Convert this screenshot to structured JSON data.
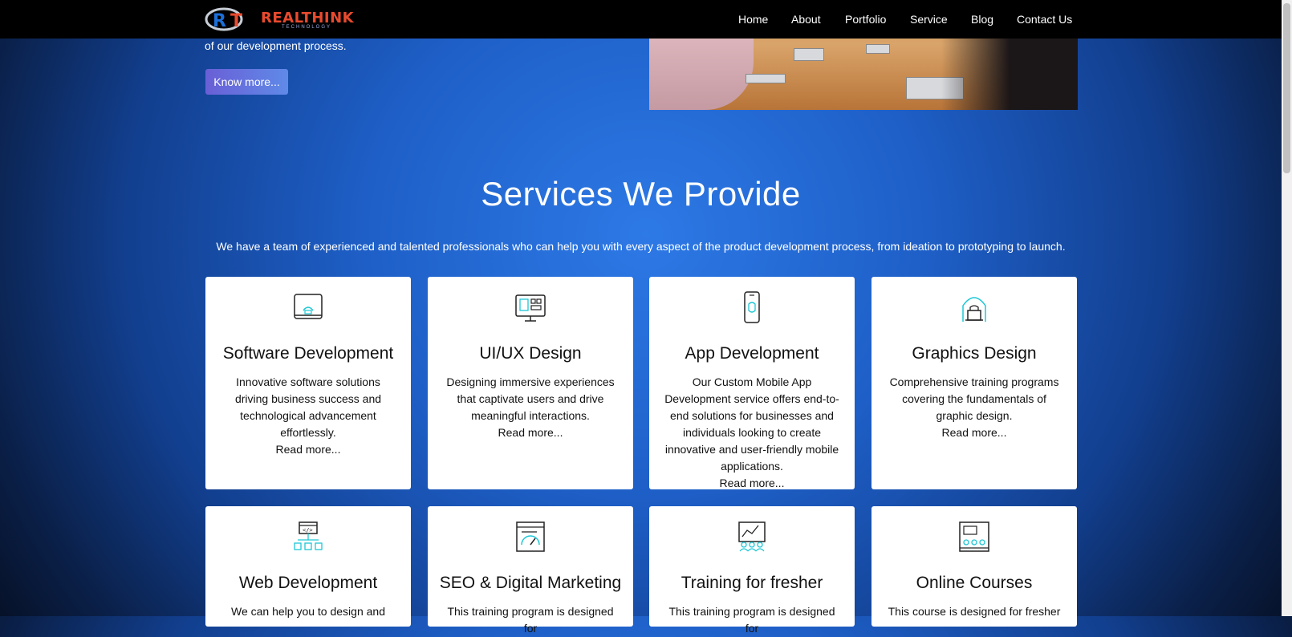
{
  "brand": {
    "name": "REALTHINK",
    "tagline": "TECHNOLOGY"
  },
  "nav": {
    "items": [
      "Home",
      "About",
      "Portfolio",
      "Service",
      "Blog",
      "Contact Us"
    ]
  },
  "hero": {
    "text": "of our development process.",
    "button_label": "Know more..."
  },
  "services": {
    "title": "Services We Provide",
    "subtitle": "We have a team of experienced and talented professionals who can help you with every aspect of the product development process, from ideation to prototyping to launch.",
    "cards": [
      {
        "icon": "laptop-icon",
        "title": "Software Development",
        "desc": "Innovative software solutions driving business success and technological advancement effortlessly.",
        "more": "Read more..."
      },
      {
        "icon": "ui-design-icon",
        "title": "UI/UX Design",
        "desc": "Designing immersive experiences that captivate users and drive meaningful interactions.",
        "more": "Read more..."
      },
      {
        "icon": "smartphone-icon",
        "title": "App Development",
        "desc": "Our Custom Mobile App Development service offers end-to-end solutions for businesses and individuals looking to create innovative and user-friendly mobile applications.",
        "more": "Read more..."
      },
      {
        "icon": "designer-icon",
        "title": "Graphics Design",
        "desc": "Comprehensive training programs covering the fundamentals of graphic design.",
        "more": "Read more..."
      },
      {
        "icon": "web-network-icon",
        "title": "Web Development",
        "desc": "We can help you to design and",
        "more": ""
      },
      {
        "icon": "seo-gauge-icon",
        "title": "SEO & Digital Marketing",
        "desc": "This training program is designed for",
        "more": ""
      },
      {
        "icon": "training-board-icon",
        "title": "Training for fresher",
        "desc": "This training program is designed for",
        "more": ""
      },
      {
        "icon": "online-course-icon",
        "title": "Online Courses",
        "desc": "This course is designed for fresher",
        "more": ""
      }
    ]
  },
  "colors": {
    "nav_bg": "#000000",
    "accent_teal": "#1ec7d6",
    "button_gradient_start": "#6a5fd6",
    "logo_red": "#e84a2e"
  }
}
